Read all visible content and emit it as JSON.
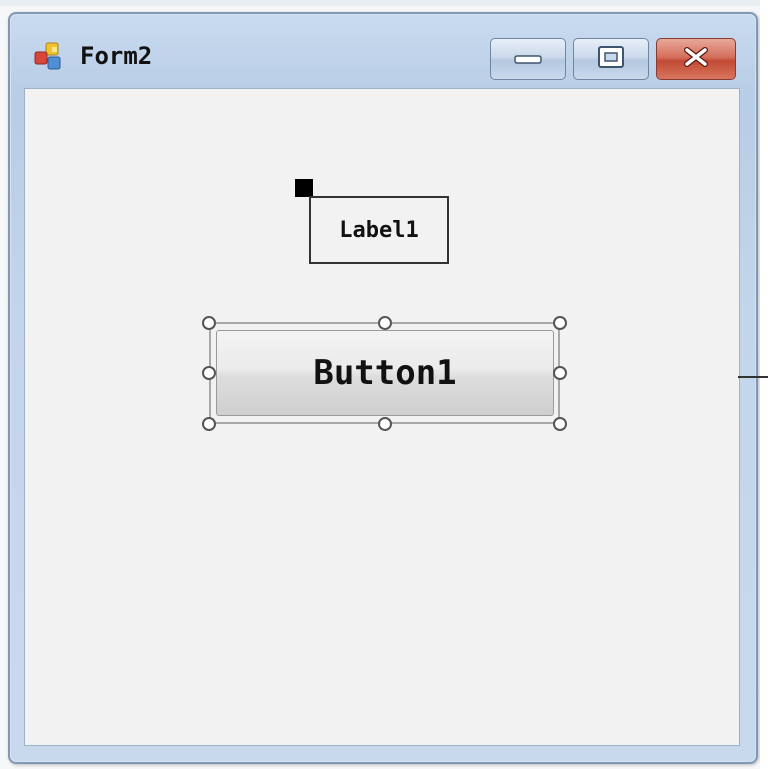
{
  "window": {
    "title": "Form2",
    "icon": "form-app-icon",
    "buttons": {
      "minimize": "minimize-icon",
      "maximize": "maximize-icon",
      "close": "close-icon"
    }
  },
  "form": {
    "label": {
      "text": "Label1"
    },
    "button": {
      "text": "Button1"
    }
  },
  "colors": {
    "titlebar": "#bcd0e8",
    "client": "#f2f2f2",
    "close_button": "#c24a33"
  }
}
